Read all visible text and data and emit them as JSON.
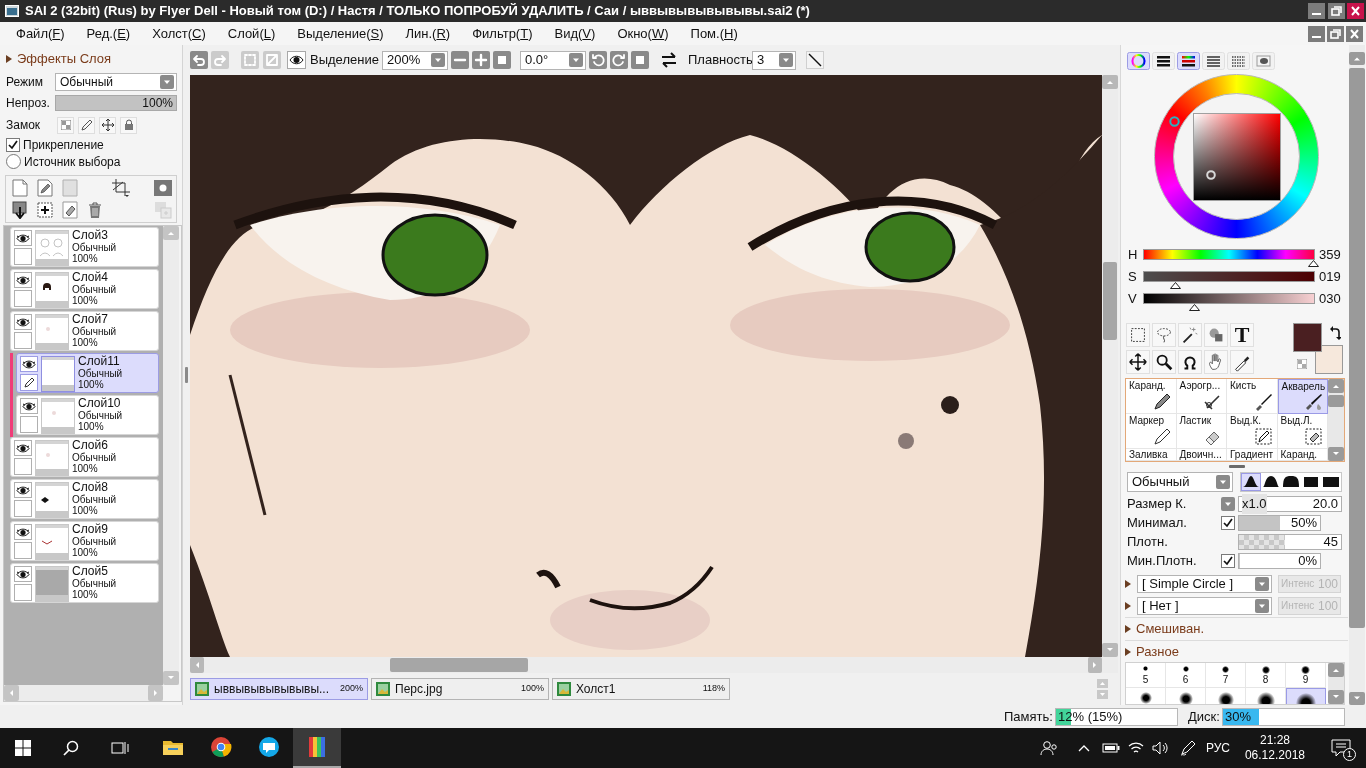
{
  "window": {
    "title": "SAI 2 (32bit) (Rus) by Flyer Dell - Новый том (D:) / Настя / ТОЛЬКО ПОПРОБУЙ УДАЛИТЬ / Саи / ыввывывывывывы.sai2 (*)"
  },
  "menu": [
    {
      "before": "Файл(",
      "accel": "F",
      "after": ")"
    },
    {
      "before": "Ред.(",
      "accel": "E",
      "after": ")"
    },
    {
      "before": "Холст(",
      "accel": "C",
      "after": ")"
    },
    {
      "before": "Слой(",
      "accel": "L",
      "after": ")"
    },
    {
      "before": "Выделение(",
      "accel": "S",
      "after": ")"
    },
    {
      "before": "Лин.(",
      "accel": "R",
      "after": ")"
    },
    {
      "before": "Фильтр(",
      "accel": "T",
      "after": ")"
    },
    {
      "before": "Вид(",
      "accel": "V",
      "after": ")"
    },
    {
      "before": "Окно(",
      "accel": "W",
      "after": ")"
    },
    {
      "before": "Пом.(",
      "accel": "H",
      "after": ")"
    }
  ],
  "toolbar": {
    "buttons": [
      {
        "kind": "undo",
        "disabled": false
      },
      {
        "kind": "redo",
        "disabled": true
      },
      {
        "kind": "select_all",
        "disabled": true
      },
      {
        "kind": "deselect",
        "disabled": true
      }
    ],
    "selection_label": "Выделение",
    "zoom": "200%",
    "angle": "0.0°",
    "smoothing_label": "Плавность",
    "smoothing": "3"
  },
  "layer_panel": {
    "effects": {
      "label": "Эффекты Слоя",
      "expanded": false
    },
    "mode": {
      "label": "Режим",
      "value": "Обычный"
    },
    "opacity": {
      "label": "Непроз.",
      "level": 1,
      "reading": "100%"
    },
    "lock": {
      "label": "Замок"
    },
    "clipping": {
      "label": "Прикрепление",
      "checked": true
    },
    "selection_source": {
      "label": "Источник выбора",
      "checked": false
    },
    "layers": [
      {
        "kind": "sketch",
        "name": "Слой3",
        "mode": "Обычный",
        "opacity": "100%",
        "visible": true,
        "clipped": false,
        "selected": false
      },
      {
        "kind": "hair",
        "name": "Слой4",
        "mode": "Обычный",
        "opacity": "100%",
        "visible": true,
        "clipped": false,
        "selected": false
      },
      {
        "kind": "faint",
        "name": "Слой7",
        "mode": "Обычный",
        "opacity": "100%",
        "visible": true,
        "clipped": false,
        "selected": false
      },
      {
        "kind": "blank",
        "name": "Слой11",
        "mode": "Обычный",
        "opacity": "100%",
        "visible": true,
        "clipped": true,
        "selected": true
      },
      {
        "kind": "faint",
        "name": "Слой10",
        "mode": "Обычный",
        "opacity": "100%",
        "visible": true,
        "clipped": true,
        "selected": false
      },
      {
        "kind": "faint",
        "name": "Слой6",
        "mode": "Обычный",
        "opacity": "100%",
        "visible": true,
        "clipped": false,
        "selected": false
      },
      {
        "kind": "blob",
        "name": "Слой8",
        "mode": "Обычный",
        "opacity": "100%",
        "visible": true,
        "clipped": false,
        "selected": false
      },
      {
        "kind": "line",
        "name": "Слой9",
        "mode": "Обычный",
        "opacity": "100%",
        "visible": true,
        "clipped": false,
        "selected": false
      },
      {
        "kind": "filled",
        "name": "Слой5",
        "mode": "Обычный",
        "opacity": "100%",
        "visible": true,
        "clipped": false,
        "selected": false
      }
    ]
  },
  "doc_tabs": [
    {
      "name": "ыввывывывывывы...",
      "zoom": "200%",
      "selected": true
    },
    {
      "name": "Перс.jpg",
      "zoom": "100%",
      "selected": false
    },
    {
      "name": "Холст1",
      "zoom": "118%",
      "selected": false
    }
  ],
  "color_panel": {
    "tabs": [
      {
        "kind": "wheel",
        "selected": true
      },
      {
        "kind": "rgb",
        "selected": false
      },
      {
        "kind": "hsv",
        "selected": true
      },
      {
        "kind": "list",
        "selected": false
      },
      {
        "kind": "grid",
        "selected": false
      },
      {
        "kind": "scratch",
        "selected": false
      }
    ],
    "sliders": [
      {
        "kind": "hue",
        "label": "H",
        "value": "359",
        "level": 0.99
      },
      {
        "kind": "sat",
        "label": "S",
        "value": "019",
        "level": 0.19
      },
      {
        "kind": "val",
        "label": "V",
        "value": "030",
        "level": 0.3
      }
    ],
    "colors": [
      {
        "kind": "main",
        "color": "#4a1f21"
      },
      {
        "kind": "sub",
        "color": "#f6e8dc"
      }
    ]
  },
  "tools": {
    "text_glyph": "T"
  },
  "brushes": {
    "items": [
      {
        "name": "Каранд.",
        "kind": "pencil",
        "selected": false
      },
      {
        "name": "Аэрогр...",
        "kind": "airbrush",
        "selected": false
      },
      {
        "name": "Кисть",
        "kind": "brush",
        "selected": false
      },
      {
        "name": "Акварель",
        "kind": "watercolor",
        "selected": true
      },
      {
        "name": "Маркер",
        "kind": "marker",
        "selected": false
      },
      {
        "name": "Ластик",
        "kind": "eraser",
        "selected": false
      },
      {
        "name": "Выд.К.",
        "kind": "select_pen",
        "selected": false
      },
      {
        "name": "Выд.Л.",
        "kind": "select_eraser",
        "selected": false
      },
      {
        "name": "Заливка",
        "selected": false
      },
      {
        "name": "Двоичн...",
        "selected": false
      },
      {
        "name": "Градиент",
        "selected": false
      },
      {
        "name": "Каранд.",
        "selected": false
      }
    ]
  },
  "brush_settings": {
    "blend": "Обычный",
    "shapes": [
      {
        "selected": true
      },
      {
        "selected": false
      },
      {
        "selected": false
      },
      {
        "selected": false
      },
      {
        "selected": false
      }
    ],
    "size": {
      "label": "Размер К.",
      "multiplier": "x1.0",
      "value": "20.0"
    },
    "min_size": {
      "label": "Минимал.",
      "checked": true,
      "level": 0.5,
      "reading": "50%"
    },
    "density": {
      "label": "Плотн.",
      "level": 0.45,
      "reading": "45"
    },
    "min_density": {
      "label": "Мин.Плотн.",
      "checked": true,
      "level": 0,
      "reading": "0%"
    },
    "textures": [
      {
        "value": "[ Simple Circle ]",
        "expanded": false,
        "intensity_label": "Интенс",
        "intensity": "100",
        "disabled": true
      },
      {
        "value": "[ Нет ]",
        "expanded": false,
        "intensity_label": "Интенс",
        "intensity": "100",
        "disabled": true
      }
    ],
    "sections": [
      {
        "label": "Смешиван.",
        "expanded": false
      },
      {
        "label": "Разное",
        "expanded": false
      }
    ],
    "sizes": [
      {
        "label": "5",
        "selected": false
      },
      {
        "label": "6",
        "selected": false
      },
      {
        "label": "7",
        "selected": false
      },
      {
        "label": "8",
        "selected": false
      },
      {
        "label": "9",
        "selected": false
      }
    ],
    "sizes_row2": [
      {
        "selected": false
      },
      {
        "selected": false
      },
      {
        "selected": false
      },
      {
        "selected": false
      },
      {
        "selected": true
      }
    ]
  },
  "status": {
    "memory": {
      "label": "Память:",
      "level": 0.12,
      "reading": "12% (15%)"
    },
    "disk": {
      "label": "Диск:",
      "level": 0.3,
      "reading": "30%"
    }
  },
  "taskbar": {
    "apps": [
      {
        "kind": "explorer",
        "selected": false
      },
      {
        "kind": "browser",
        "selected": false
      },
      {
        "kind": "messenger",
        "selected": false
      },
      {
        "kind": "paint",
        "selected": true
      }
    ],
    "language": "РУС",
    "time": "21:28",
    "date": "06.12.2018",
    "notifications": "1"
  }
}
